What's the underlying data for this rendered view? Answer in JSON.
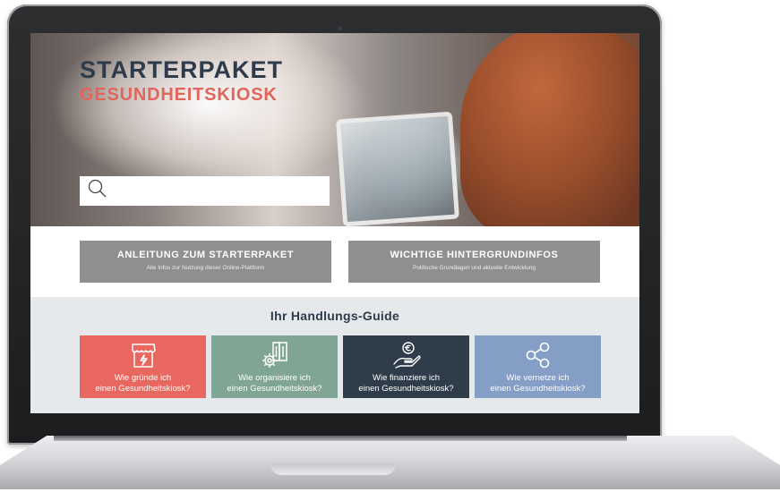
{
  "hero": {
    "title": "STARTERPAKET",
    "subtitle": "GESUNDHEITSKIOSK",
    "search": {
      "placeholder": "",
      "value": ""
    }
  },
  "info_buttons": [
    {
      "title": "ANLEITUNG ZUM STARTERPAKET",
      "subtitle": "Alle Infos zur Nutzung dieser Online-Plattform"
    },
    {
      "title": "WICHTIGE HINTERGRUNDINFOS",
      "subtitle": "Politische Grundlagen und aktuelle Entwicklung"
    }
  ],
  "guide": {
    "title": "Ihr Handlungs-Guide",
    "cards": [
      {
        "line1": "Wie gründe ich",
        "line2": "einen Gesundheitskiosk?",
        "color": "#e8685f",
        "icon": "kiosk-store-icon"
      },
      {
        "line1": "Wie organisiere ich",
        "line2": "einen Gesundheitskiosk?",
        "color": "#80a595",
        "icon": "gear-documents-icon"
      },
      {
        "line1": "Wie finanziere ich",
        "line2": "einen Gesundheitskiosk?",
        "color": "#2f3d4a",
        "icon": "hand-coin-icon"
      },
      {
        "line1": "Wie vernetze ich",
        "line2": "einen Gesundheitskiosk?",
        "color": "#859ec6",
        "icon": "share-network-icon"
      }
    ]
  }
}
